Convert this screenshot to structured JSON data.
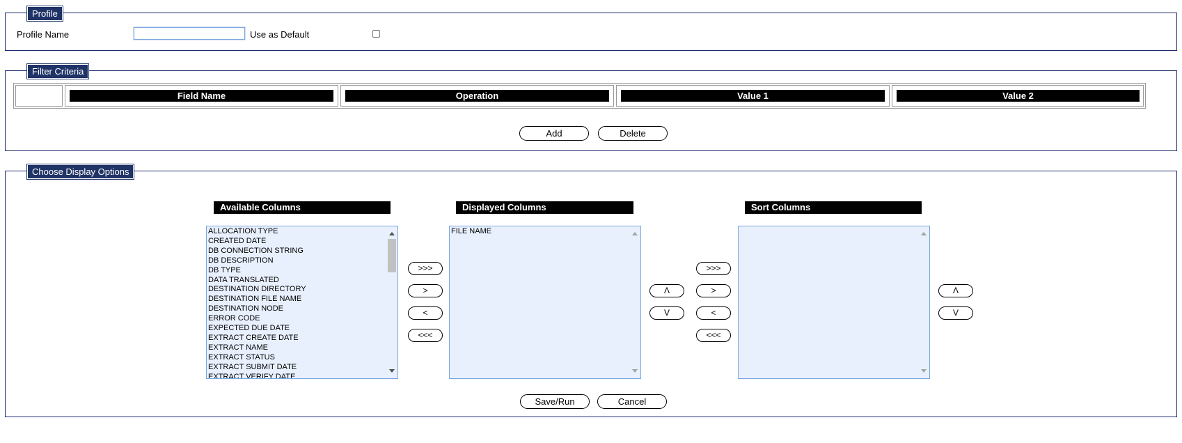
{
  "profile": {
    "legend": "Profile",
    "name_label": "Profile Name",
    "name_value": "",
    "default_label": "Use as Default",
    "default_checked": false
  },
  "filter": {
    "legend": "Filter Criteria",
    "headers": [
      "Field Name",
      "Operation",
      "Value 1",
      "Value 2"
    ],
    "add_label": "Add",
    "delete_label": "Delete"
  },
  "display": {
    "legend": "Choose Display Options",
    "available": {
      "title": "Available Columns",
      "items": [
        "ALLOCATION TYPE",
        "CREATED DATE",
        "DB CONNECTION STRING",
        "DB DESCRIPTION",
        "DB TYPE",
        "DATA TRANSLATED",
        "DESTINATION DIRECTORY",
        "DESTINATION FILE NAME",
        "DESTINATION NODE",
        "ERROR CODE",
        "EXPECTED DUE DATE",
        "EXTRACT CREATE DATE",
        "EXTRACT NAME",
        "EXTRACT STATUS",
        "EXTRACT SUBMIT DATE",
        "EXTRACT VERIFY DATE"
      ]
    },
    "displayed": {
      "title": "Displayed Columns",
      "items": [
        "FILE NAME"
      ]
    },
    "sort": {
      "title": "Sort Columns",
      "items": []
    },
    "move_buttons": {
      "add_all": ">>>",
      "add": ">",
      "remove": "<",
      "remove_all": "<<<"
    },
    "order_buttons": {
      "up": "Λ",
      "down": "V"
    },
    "save_run_label": "Save/Run",
    "cancel_label": "Cancel"
  }
}
